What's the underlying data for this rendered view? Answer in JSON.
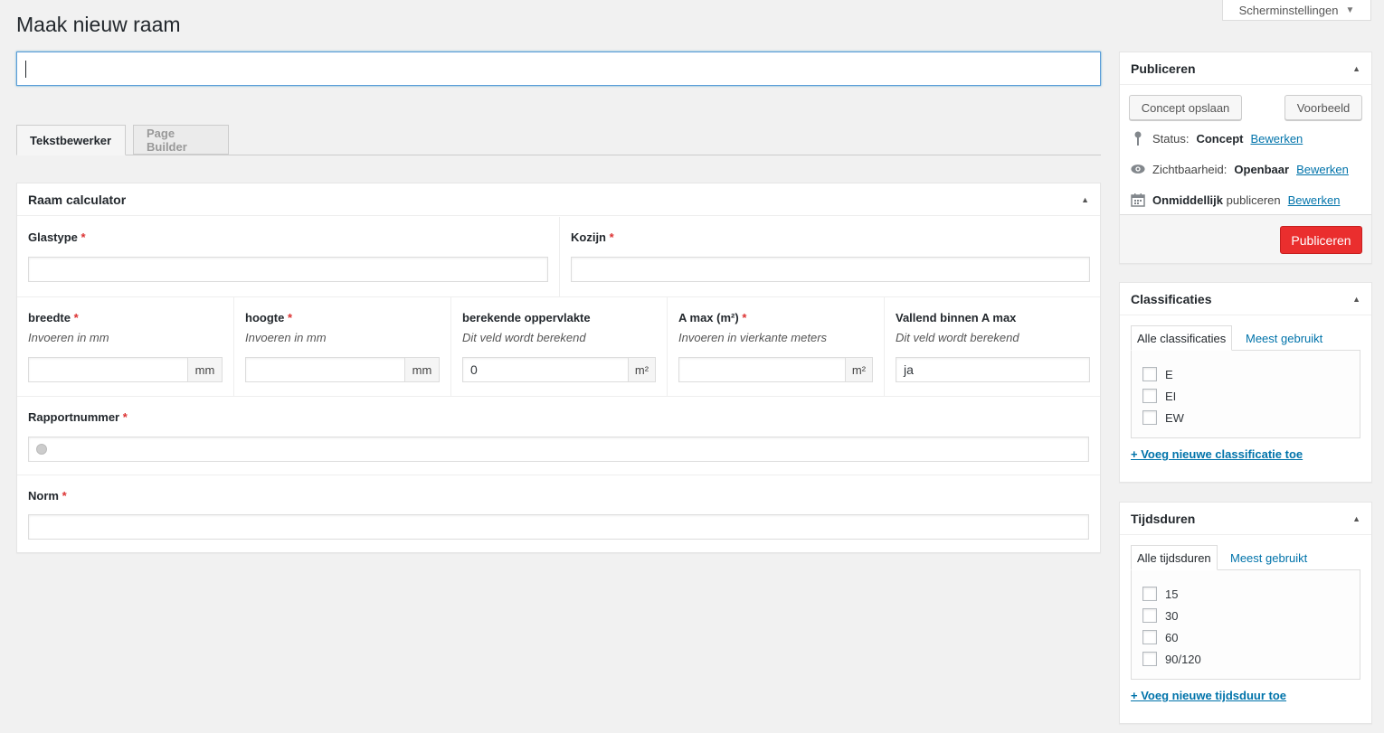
{
  "screen_options": {
    "label": "Scherminstellingen"
  },
  "page": {
    "title": "Maak nieuw raam",
    "title_input_value": ""
  },
  "editor_tabs": [
    {
      "label": "Tekstbewerker"
    },
    {
      "label": "Page Builder"
    }
  ],
  "calculator": {
    "title": "Raam calculator",
    "required_mark": "*",
    "glastype": {
      "label": "Glastype",
      "value": ""
    },
    "kozijn": {
      "label": "Kozijn",
      "value": ""
    },
    "breedte": {
      "label": "breedte",
      "hint": "Invoeren in mm",
      "value": "",
      "append": "mm"
    },
    "hoogte": {
      "label": "hoogte",
      "hint": "Invoeren in mm",
      "value": "",
      "append": "mm"
    },
    "oppervlakte": {
      "label": "berekende oppervlakte",
      "hint": "Dit veld wordt berekend",
      "value": "0",
      "append": "m²"
    },
    "amax": {
      "label": "A max (m²)",
      "hint": "Invoeren in vierkante meters",
      "value": "",
      "append": "m²"
    },
    "vallend": {
      "label": "Vallend binnen A max",
      "hint": "Dit veld wordt berekend",
      "value": "ja"
    },
    "rapportnummer": {
      "label": "Rapportnummer",
      "value": ""
    },
    "norm": {
      "label": "Norm",
      "value": ""
    }
  },
  "publish": {
    "title": "Publiceren",
    "save_draft": "Concept opslaan",
    "preview": "Voorbeeld",
    "status_label": "Status:",
    "status_value": "Concept",
    "visibility_label": "Zichtbaarheid:",
    "visibility_value": "Openbaar",
    "schedule_strong": "Onmiddellijk",
    "schedule_rest": "publiceren",
    "edit_link": "Bewerken",
    "publish_button": "Publiceren",
    "accent_color": "#ea2e2e"
  },
  "classificaties": {
    "title": "Classificaties",
    "tab_all": "Alle classificaties",
    "tab_popular": "Meest gebruikt",
    "items": [
      "E",
      "EI",
      "EW"
    ],
    "add_link": "+ Voeg nieuwe classificatie toe"
  },
  "tijdsduren": {
    "title": "Tijdsduren",
    "tab_all": "Alle tijdsduren",
    "tab_popular": "Meest gebruikt",
    "items": [
      "15",
      "30",
      "60",
      "90/120"
    ],
    "add_link": "+ Voeg nieuwe tijdsduur toe"
  }
}
